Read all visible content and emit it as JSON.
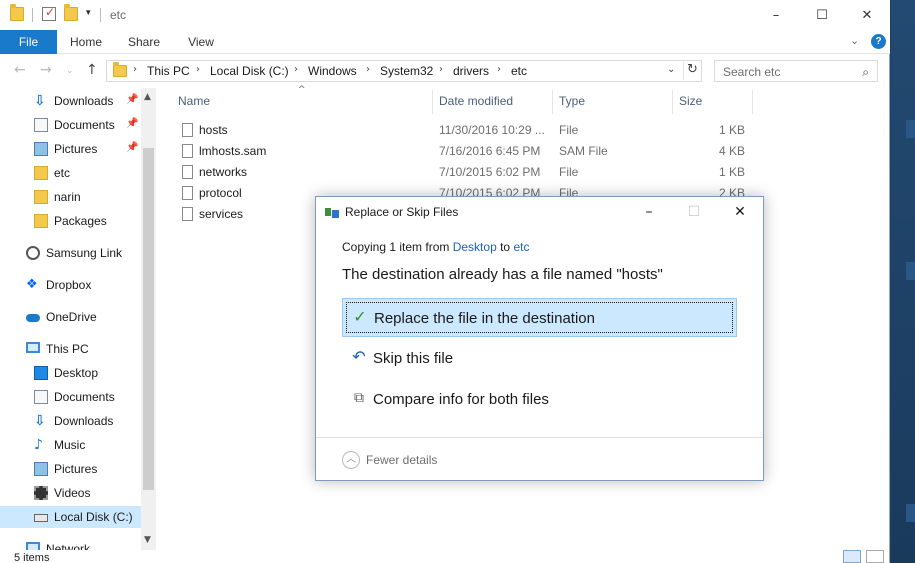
{
  "window": {
    "title": "etc"
  },
  "ribbon": {
    "tabs": [
      "File",
      "Home",
      "Share",
      "View"
    ],
    "help_label": "?"
  },
  "address": {
    "crumbs": [
      "This PC",
      "Local Disk (C:)",
      "Windows",
      "System32",
      "drivers",
      "etc"
    ]
  },
  "search": {
    "placeholder": "Search etc"
  },
  "nav": {
    "items": [
      {
        "label": "Downloads",
        "icon": "download-icon",
        "pinned": true
      },
      {
        "label": "Documents",
        "icon": "documents-icon",
        "pinned": true
      },
      {
        "label": "Pictures",
        "icon": "pictures-icon",
        "pinned": true
      },
      {
        "label": "etc",
        "icon": "folder-icon"
      },
      {
        "label": "narin",
        "icon": "folder-icon"
      },
      {
        "label": "Packages",
        "icon": "folder-icon"
      },
      {
        "label": "Samsung Link",
        "icon": "samsung-link-icon"
      },
      {
        "label": "Dropbox",
        "icon": "dropbox-icon"
      },
      {
        "label": "OneDrive",
        "icon": "onedrive-icon"
      },
      {
        "label": "This PC",
        "icon": "this-pc-icon"
      },
      {
        "label": "Desktop",
        "icon": "desktop-icon"
      },
      {
        "label": "Documents",
        "icon": "documents-icon"
      },
      {
        "label": "Downloads",
        "icon": "download-icon"
      },
      {
        "label": "Music",
        "icon": "music-icon"
      },
      {
        "label": "Pictures",
        "icon": "pictures-icon"
      },
      {
        "label": "Videos",
        "icon": "videos-icon"
      },
      {
        "label": "Local Disk (C:)",
        "icon": "local-disk-icon",
        "selected": true
      },
      {
        "label": "Network",
        "icon": "network-icon"
      }
    ]
  },
  "columns": [
    "Name",
    "Date modified",
    "Type",
    "Size"
  ],
  "files": [
    {
      "name": "hosts",
      "date": "11/30/2016 10:29 ...",
      "type": "File",
      "size": "1 KB"
    },
    {
      "name": "lmhosts.sam",
      "date": "7/16/2016 6:45 PM",
      "type": "SAM File",
      "size": "4 KB"
    },
    {
      "name": "networks",
      "date": "7/10/2015 6:02 PM",
      "type": "File",
      "size": "1 KB"
    },
    {
      "name": "protocol",
      "date": "7/10/2015 6:02 PM",
      "type": "File",
      "size": "2 KB"
    },
    {
      "name": "services",
      "date": "",
      "type": "",
      "size": ""
    }
  ],
  "status": {
    "items_count": "5 items"
  },
  "dialog": {
    "title": "Replace or Skip Files",
    "info_prefix": "Copying 1 item from",
    "info_source": "Desktop",
    "info_mid": "to",
    "info_dest": "etc",
    "headline": "The destination already has a file named \"hosts\"",
    "options": [
      {
        "label": "Replace the file in the destination",
        "icon": "check-icon",
        "selected": true
      },
      {
        "label": "Skip this file",
        "icon": "skip-icon"
      },
      {
        "label": "Compare info for both files",
        "icon": "compare-icon"
      }
    ],
    "fewer_details": "Fewer details"
  },
  "colors": {
    "accent": "#1979ca",
    "selection": "#cce8ff",
    "link": "#1a62b8"
  }
}
